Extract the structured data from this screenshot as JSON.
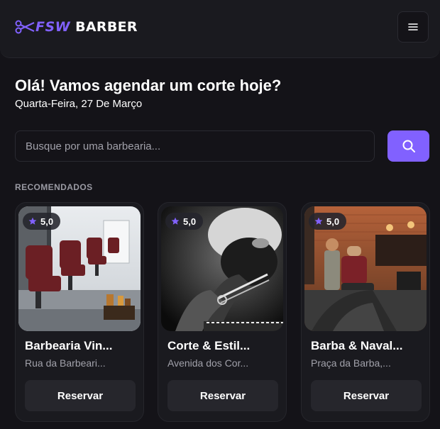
{
  "colors": {
    "accent": "#8161ff",
    "background": "#141318",
    "card": "#1a1a1f"
  },
  "header": {
    "logo_accent": "FSW",
    "logo_text": "BARBER",
    "logo_icon": "scissors-icon",
    "menu_icon": "menu-icon"
  },
  "greeting": "Olá! Vamos agendar um corte hoje?",
  "date": "Quarta-Feira, 27 De Março",
  "search": {
    "placeholder": "Busque por uma barbearia...",
    "value": "",
    "icon": "search-icon"
  },
  "section_title": "RECOMENDADOS",
  "barbershops": [
    {
      "rating": "5,0",
      "name": "Barbearia Vin...",
      "address": "Rua da Barbeari...",
      "button": "Reservar"
    },
    {
      "rating": "5,0",
      "name": "Corte & Estil...",
      "address": "Avenida dos Cor...",
      "button": "Reservar"
    },
    {
      "rating": "5,0",
      "name": "Barba & Naval...",
      "address": "Praça da Barba,...",
      "button": "Reservar"
    }
  ]
}
